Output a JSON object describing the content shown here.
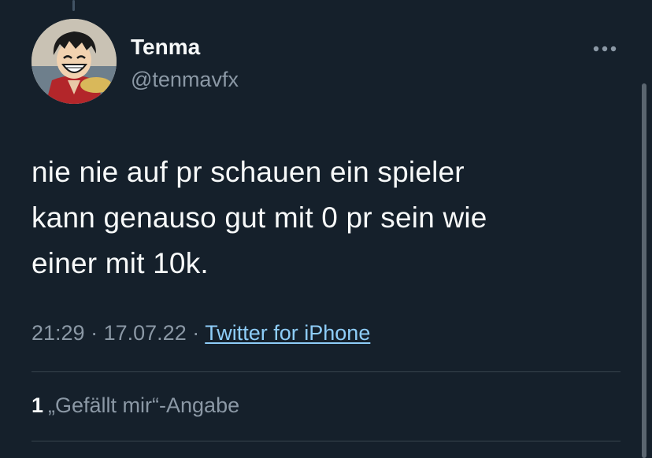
{
  "tweet": {
    "author": {
      "display_name": "Tenma",
      "handle": "@tenmavfx"
    },
    "text_lines": [
      "nie nie auf pr schauen ein spieler",
      "kann genauso gut mit 0 pr sein wie",
      "einer mit 10k."
    ],
    "time": "21:29",
    "date": "17.07.22",
    "separator": "·",
    "source": "Twitter for iPhone",
    "likes_count": "1",
    "likes_label": "„Gefällt mir“-Angabe"
  },
  "icons": {
    "more": "more-horizontal-icon",
    "avatar": "profile-avatar"
  },
  "colors": {
    "background": "#15202b",
    "primary_text": "#f7f9f9",
    "secondary_text": "#8b98a5",
    "link": "#8ecdf8",
    "divider": "#38444d"
  }
}
